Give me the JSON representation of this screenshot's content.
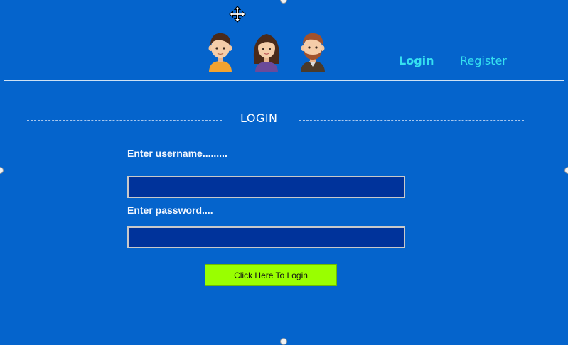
{
  "header": {
    "nav": {
      "login": "Login",
      "register": "Register"
    }
  },
  "form": {
    "heading": "LOGIN",
    "username_label": "Enter username.........",
    "username_value": "",
    "password_label": "Enter password....",
    "password_value": "",
    "submit_label": "Click Here To Login"
  },
  "icons": {
    "move": "move-cursor-icon",
    "avatars": [
      "boy-avatar-icon",
      "girl-avatar-icon",
      "bearded-man-avatar-icon"
    ]
  },
  "colors": {
    "background": "#0564cc",
    "nav_link": "#35e0f0",
    "input_fill": "#00339b",
    "button": "#99ff00"
  }
}
